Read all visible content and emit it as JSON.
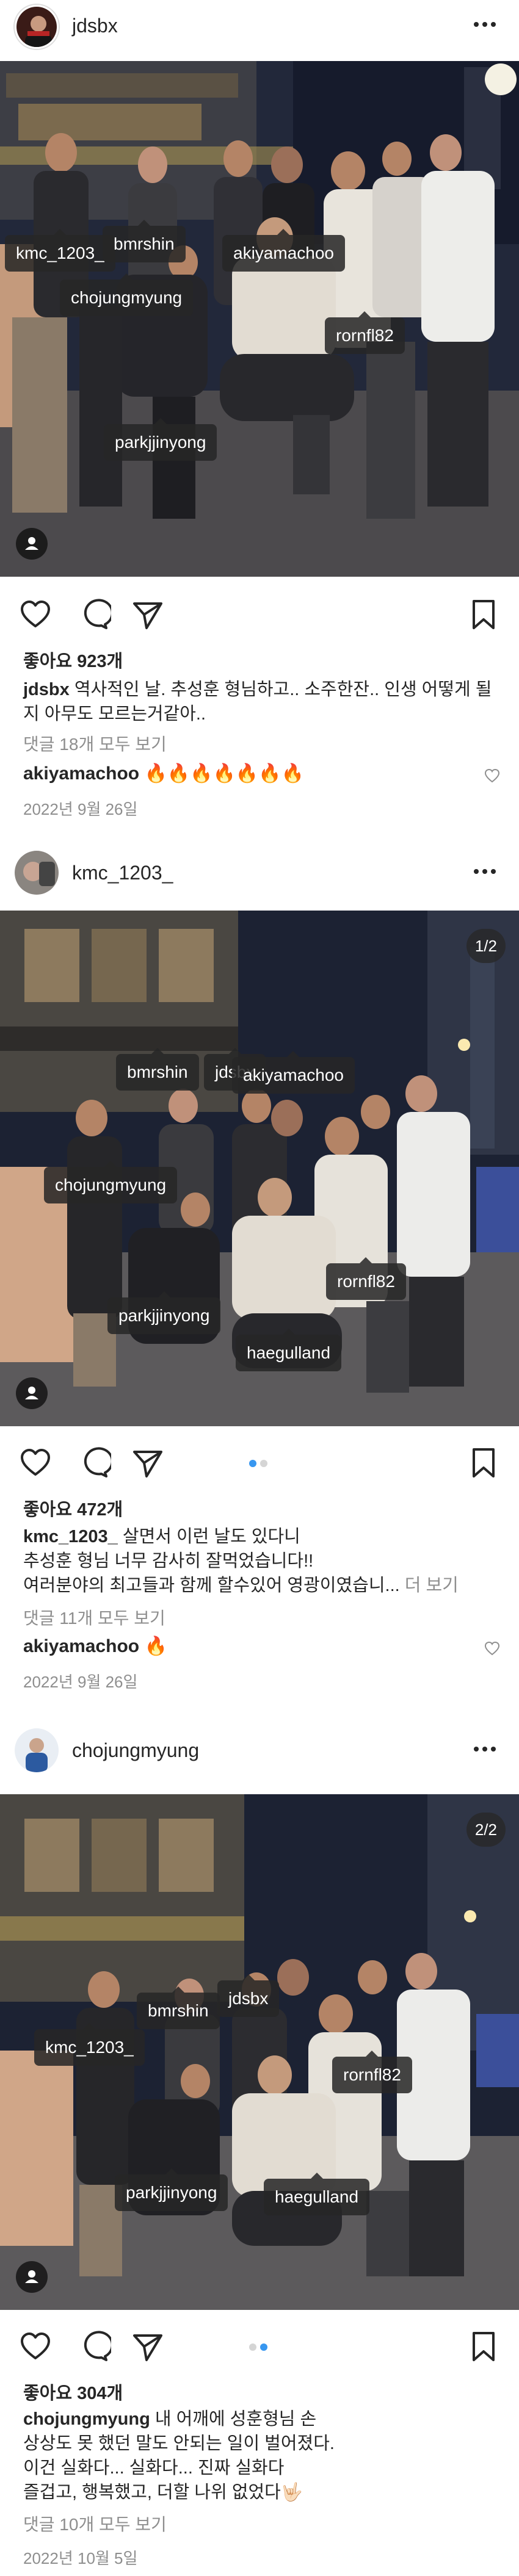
{
  "posts": [
    {
      "username": "jdsbx",
      "tags": [
        "kmc_1203_",
        "bmrshin",
        "akiyamachoo",
        "chojungmyung",
        "rornfl82",
        "parkjjinyong"
      ],
      "likes": "좋아요 923개",
      "caption_user": "jdsbx",
      "caption_text": "역사적인 날. 추성훈 형님하고.. 소주한잔.. 인생 어떻게 될지 아무도 모르는거같아..",
      "more": "",
      "view_comments": "댓글 18개 모두 보기",
      "comment_user": "akiyamachoo",
      "comment_text": "🔥🔥🔥🔥🔥🔥🔥",
      "date": "2022년 9월 26일"
    },
    {
      "username": "kmc_1203_",
      "counter": "1/2",
      "tags": [
        "bmrshin",
        "jdsbx",
        "akiyamachoo",
        "chojungmyung",
        "rornfl82",
        "parkjjinyong",
        "haegulland"
      ],
      "likes": "좋아요 472개",
      "caption_user": "kmc_1203_",
      "caption_text": "살면서 이런 날도 있다니",
      "caption_line2": "추성훈 형님 너무 감사히 잘먹었습니다!!",
      "caption_line3": "여러분야의 최고들과 함께 할수있어 영광이였습니...",
      "more": "더 보기",
      "view_comments": "댓글 11개 모두 보기",
      "comment_user": "akiyamachoo",
      "comment_text": "🔥",
      "date": "2022년 9월 26일"
    },
    {
      "username": "chojungmyung",
      "counter": "2/2",
      "tags": [
        "bmrshin",
        "jdsbx",
        "kmc_1203_",
        "rornfl82",
        "parkjjinyong",
        "haegulland"
      ],
      "likes": "좋아요 304개",
      "caption_user": "chojungmyung",
      "caption_text": "내 어깨에 성훈형님 손",
      "caption_line2": "상상도 못 했던 말도 안되는 일이 벌어졌다.",
      "caption_line3": "이건 실화다... 실화다... 진짜 실화다",
      "caption_line4": "즐겁고, 행복했고, 더할 나위 없었다🤟🏻",
      "view_comments": "댓글 10개 모두 보기",
      "date": "2022년 10월 5일"
    }
  ],
  "colors": {
    "text": "#262626",
    "muted": "#8e8e8e",
    "accent": "#3897f0"
  },
  "icons": [
    "heart-icon",
    "comment-icon",
    "share-icon",
    "bookmark-icon",
    "more-icon",
    "user-tag-icon"
  ]
}
